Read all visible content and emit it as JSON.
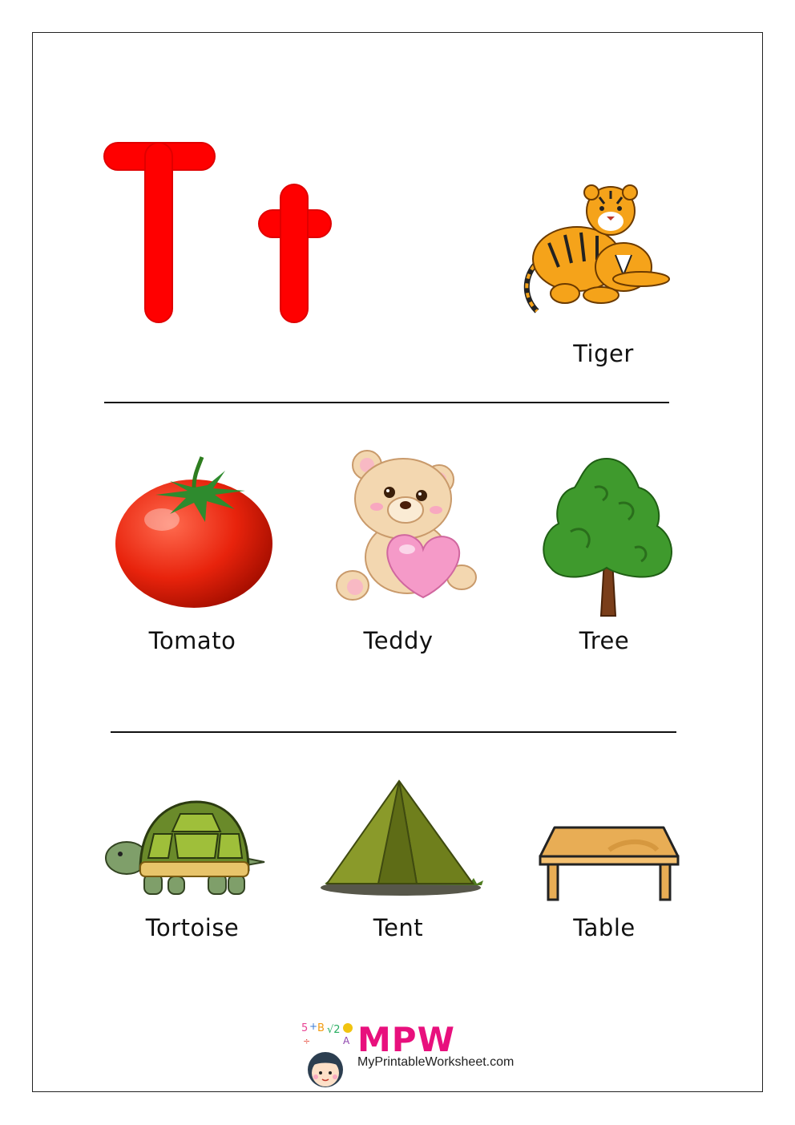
{
  "letters": {
    "upper": "T",
    "lower": "t",
    "color": "#ff0000"
  },
  "rows": [
    {
      "items": [
        {
          "label": "Tiger",
          "icon": "tiger-icon"
        }
      ]
    },
    {
      "items": [
        {
          "label": "Tomato",
          "icon": "tomato-icon"
        },
        {
          "label": "Teddy",
          "icon": "teddy-icon"
        },
        {
          "label": "Tree",
          "icon": "tree-icon"
        }
      ]
    },
    {
      "items": [
        {
          "label": "Tortoise",
          "icon": "tortoise-icon"
        },
        {
          "label": "Tent",
          "icon": "tent-icon"
        },
        {
          "label": "Table",
          "icon": "table-icon"
        }
      ]
    }
  ],
  "brand": {
    "logo": "MPW",
    "site": "MyPrintableWorksheet.com",
    "accent": "#e8107d"
  }
}
